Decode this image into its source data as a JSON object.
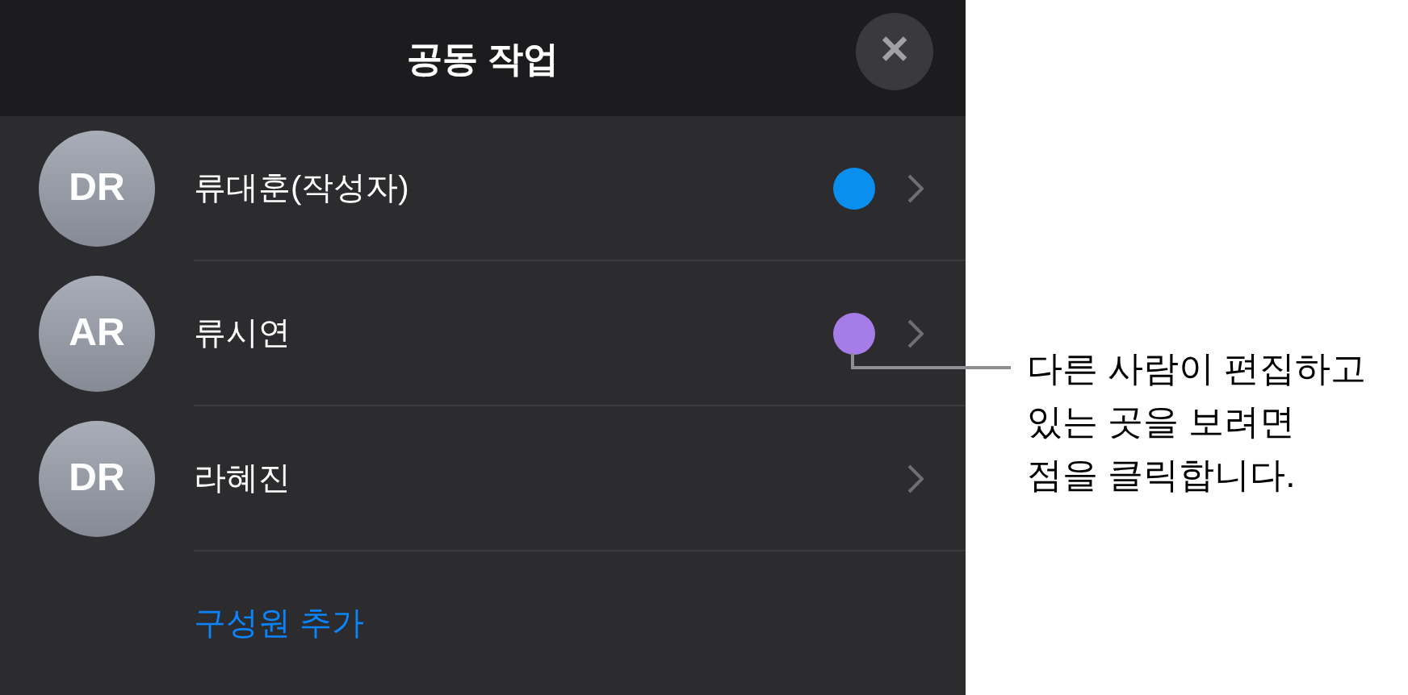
{
  "header": {
    "title": "공동 작업",
    "close": "✕"
  },
  "members": [
    {
      "initials": "DR",
      "name": "류대훈(작성자)",
      "color": "#0a8fef"
    },
    {
      "initials": "AR",
      "name": "류시연",
      "color": "#a67ce8",
      "callout": "다른 사람이 편집하고\n있는 곳을 보려면\n점을 클릭합니다."
    },
    {
      "initials": "DR",
      "name": "라혜진"
    }
  ],
  "add_member": "구성원 추가"
}
